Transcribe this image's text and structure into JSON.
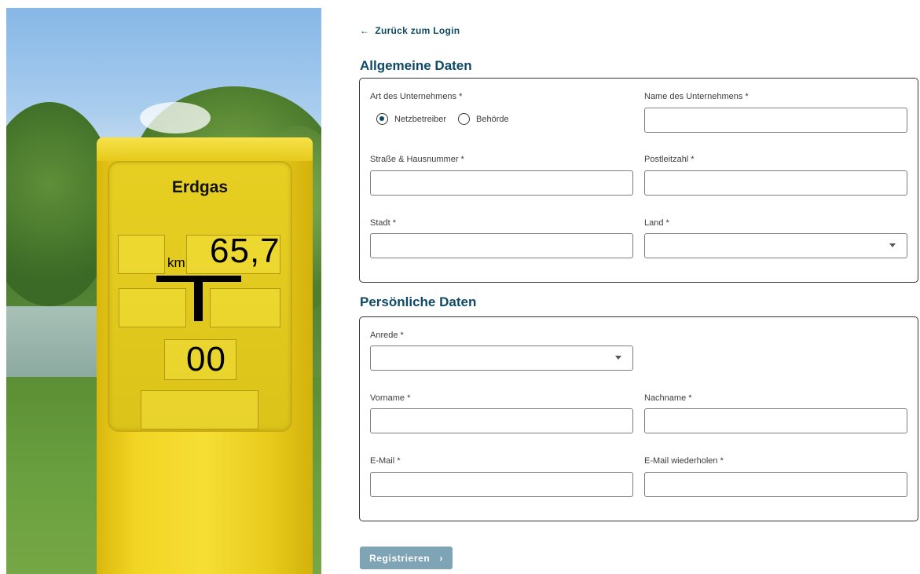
{
  "nav": {
    "back_icon": "arrow-left-icon",
    "back_label": "Zurück zum Login"
  },
  "photo": {
    "sign_title": "Erdgas",
    "unit": "km",
    "value_main": "65,7",
    "value_secondary": "00"
  },
  "general": {
    "title": "Allgemeine Daten",
    "company_type_label": "Art des Unternehmens *",
    "company_type_options": [
      "Netzbetreiber",
      "Behörde"
    ],
    "company_type_selected": "Netzbetreiber",
    "company_name_label": "Name des Unternehmens *",
    "company_name_value": "",
    "street_label": "Straße & Hausnummer *",
    "street_value": "",
    "zip_label": "Postleitzahl *",
    "zip_value": "",
    "city_label": "Stadt *",
    "city_value": "",
    "country_label": "Land *",
    "country_value": ""
  },
  "personal": {
    "title": "Persönliche Daten",
    "salutation_label": "Anrede *",
    "salutation_value": "",
    "firstname_label": "Vorname *",
    "firstname_value": "",
    "lastname_label": "Nachname *",
    "lastname_value": "",
    "email_label": "E-Mail *",
    "email_value": "",
    "email_repeat_label": "E-Mail wiederholen *",
    "email_repeat_value": ""
  },
  "submit": {
    "label": "Registrieren",
    "icon": "chevron-right-icon"
  },
  "colors": {
    "accent": "#0e4a66",
    "button": "#7ea4b6",
    "border": "#333333"
  }
}
